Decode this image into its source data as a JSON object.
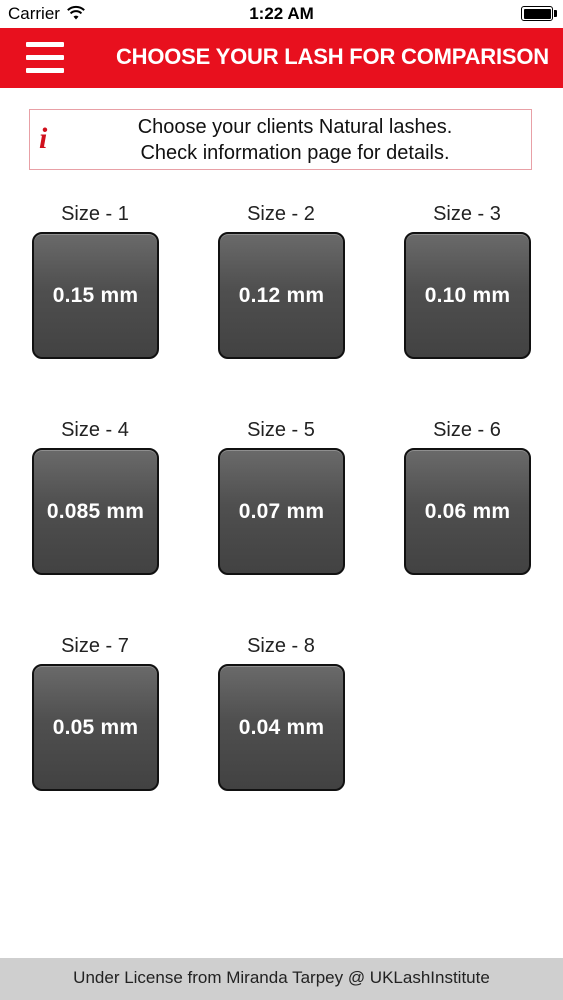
{
  "status_bar": {
    "carrier": "Carrier",
    "time": "1:22 AM",
    "wifi_icon": "wifi-icon",
    "battery_icon": "battery-icon"
  },
  "header": {
    "title": "CHOOSE YOUR LASH FOR COMPARISON",
    "menu_icon": "hamburger-menu-icon",
    "background_color": "#e8101e"
  },
  "info": {
    "icon": "i",
    "line1": "Choose your clients Natural lashes.",
    "line2": "Check information page for details."
  },
  "sizes": [
    {
      "label": "Size - 1",
      "value": "0.15 mm"
    },
    {
      "label": "Size - 2",
      "value": "0.12 mm"
    },
    {
      "label": "Size - 3",
      "value": "0.10 mm"
    },
    {
      "label": "Size - 4",
      "value": "0.085 mm"
    },
    {
      "label": "Size - 5",
      "value": "0.07 mm"
    },
    {
      "label": "Size - 6",
      "value": "0.06 mm"
    },
    {
      "label": "Size - 7",
      "value": "0.05 mm"
    },
    {
      "label": "Size - 8",
      "value": "0.04 mm"
    }
  ],
  "footer": {
    "text": "Under License from Miranda Tarpey @ UKLashInstitute"
  }
}
